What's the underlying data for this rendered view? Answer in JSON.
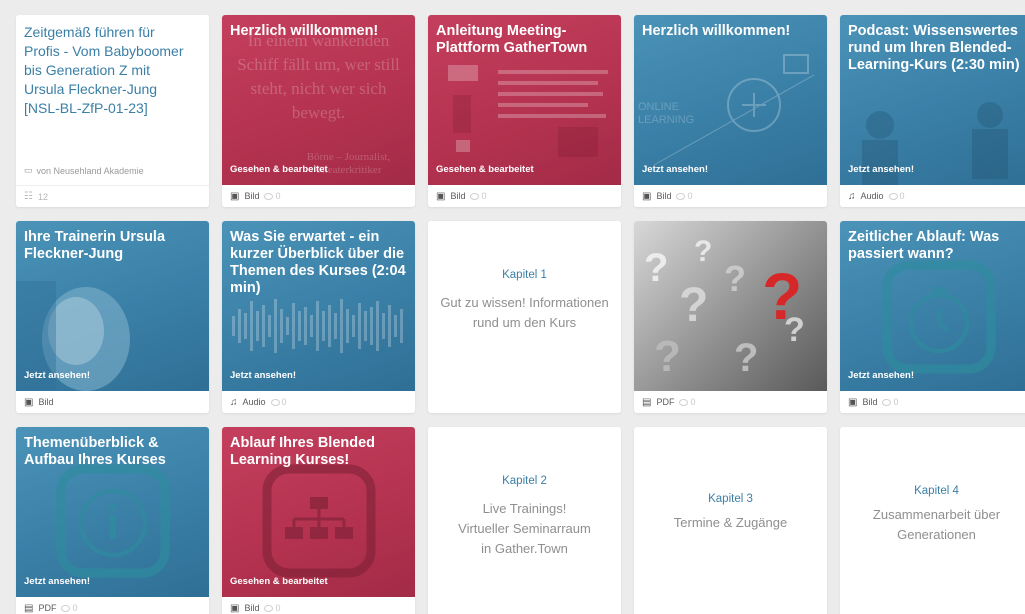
{
  "course": {
    "title": "Zeitgemäß führen für Profis - Vom Babyboomer bis Generation Z mit Ursula Fleckner-Jung [NSL-BL-ZfP-01-23]",
    "provider": "von Neusehland Akademie",
    "members": "12"
  },
  "cards": [
    {
      "title": "Herzlich willkommen!",
      "status": "Gesehen & bearbeitet",
      "type": "Bild",
      "comments": "0",
      "watermark": "In einem wankenden Schiff fällt um, wer still steht, nicht wer sich bewegt.",
      "watermark_sub": "Börne – Journalist, Theaterkritiker"
    },
    {
      "title": "Anleitung Meeting-Plattform GatherTown",
      "status": "Gesehen & bearbeitet",
      "type": "Bild",
      "comments": "0"
    },
    {
      "title": "Herzlich willkommen!",
      "status": "Jetzt ansehen!",
      "type": "Bild",
      "comments": "0",
      "watermark": "ONLINE LEARNING"
    },
    {
      "title": "Podcast: Wissenswertes rund um Ihren Blended-Learning-Kurs (2:30 min)",
      "status": "Jetzt ansehen!",
      "type": "Audio",
      "comments": "0"
    },
    {
      "title": "Ihre Trainerin Ursula Fleckner-Jung",
      "status": "Jetzt ansehen!",
      "type": "Bild",
      "comments": ""
    },
    {
      "title": "Was Sie erwartet - ein kurzer Überblick über die Themen des Kurses (2:04 min)",
      "status": "Jetzt ansehen!",
      "type": "Audio",
      "comments": "0"
    },
    {
      "chapter": "Kapitel 1",
      "text": "Gut zu wissen! Informationen rund um den Kurs"
    },
    {
      "title": "",
      "status": "",
      "type": "PDF",
      "comments": "0"
    },
    {
      "title": "Zeitlicher Ablauf: Was passiert wann?",
      "status": "Jetzt ansehen!",
      "type": "Bild",
      "comments": "0"
    },
    {
      "title": "Themenüberblick & Aufbau Ihres Kurses",
      "status": "Jetzt ansehen!",
      "type": "PDF",
      "comments": "0"
    },
    {
      "title": "Ablauf Ihres Blended Learning Kurses!",
      "status": "Gesehen & bearbeitet",
      "type": "Bild",
      "comments": "0"
    },
    {
      "chapter": "Kapitel 2",
      "text": "Live Trainings! Virtueller Seminarraum in Gather.Town"
    },
    {
      "chapter": "Kapitel 3",
      "text": "Termine & Zugänge"
    },
    {
      "chapter": "Kapitel 4",
      "text": "Zusammenarbeit über Generationen"
    }
  ],
  "colors": {
    "blue": "#3a7fa6",
    "red": "#b3324f",
    "chapter_text": "#8f8f8f"
  }
}
